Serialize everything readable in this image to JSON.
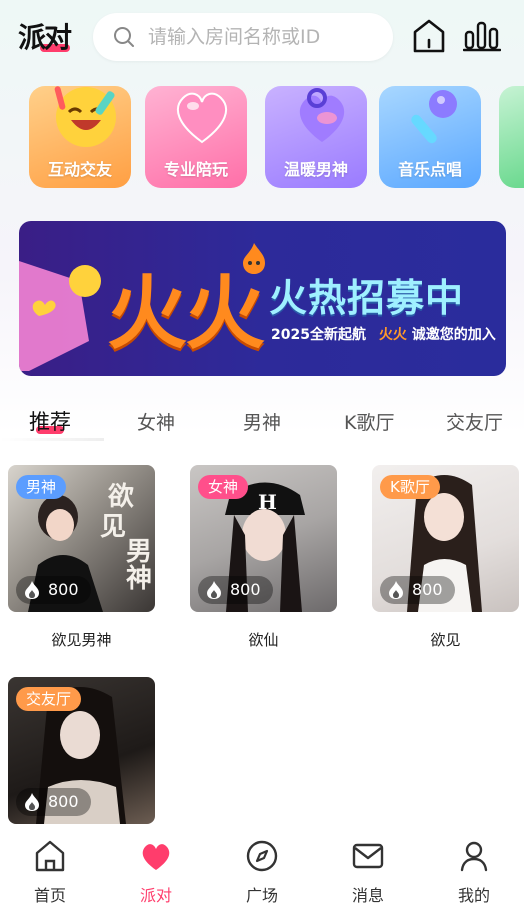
{
  "header": {
    "logo_text": "派对",
    "search_placeholder": "请输入房间名称或ID"
  },
  "categories": [
    {
      "label": "互动交友",
      "color": "#ffb35c"
    },
    {
      "label": "专业陪玩",
      "color": "#ff7fb1"
    },
    {
      "label": "温暖男神",
      "color": "#b18cff"
    },
    {
      "label": "音乐点唱",
      "color": "#6fb5ff"
    }
  ],
  "banner": {
    "big_text": "火火",
    "title": "火热招募中",
    "sub_prefix": "2025全新起航",
    "sub_highlight": "火火",
    "sub_suffix": "诚邀您的加入"
  },
  "tabs": [
    "推荐",
    "女神",
    "男神",
    "K歌厅",
    "交友厅"
  ],
  "rooms": [
    {
      "badge": "男神",
      "badge_color": "#5b9dff",
      "heat": "800",
      "name": "欲见男神"
    },
    {
      "badge": "女神",
      "badge_color": "#ff4f8b",
      "heat": "800",
      "name": "欲仙"
    },
    {
      "badge": "K歌厅",
      "badge_color": "#ff9a4a",
      "heat": "800",
      "name": "欲见"
    },
    {
      "badge": "交友厅",
      "badge_color": "#ff9a4a",
      "heat": "800",
      "name": ""
    }
  ],
  "nav": [
    {
      "label": "首页",
      "icon": "home-icon"
    },
    {
      "label": "派对",
      "icon": "heart-icon"
    },
    {
      "label": "广场",
      "icon": "compass-icon"
    },
    {
      "label": "消息",
      "icon": "mail-icon"
    },
    {
      "label": "我的",
      "icon": "user-icon"
    }
  ],
  "colors": {
    "accent": "#ff3d6c"
  }
}
